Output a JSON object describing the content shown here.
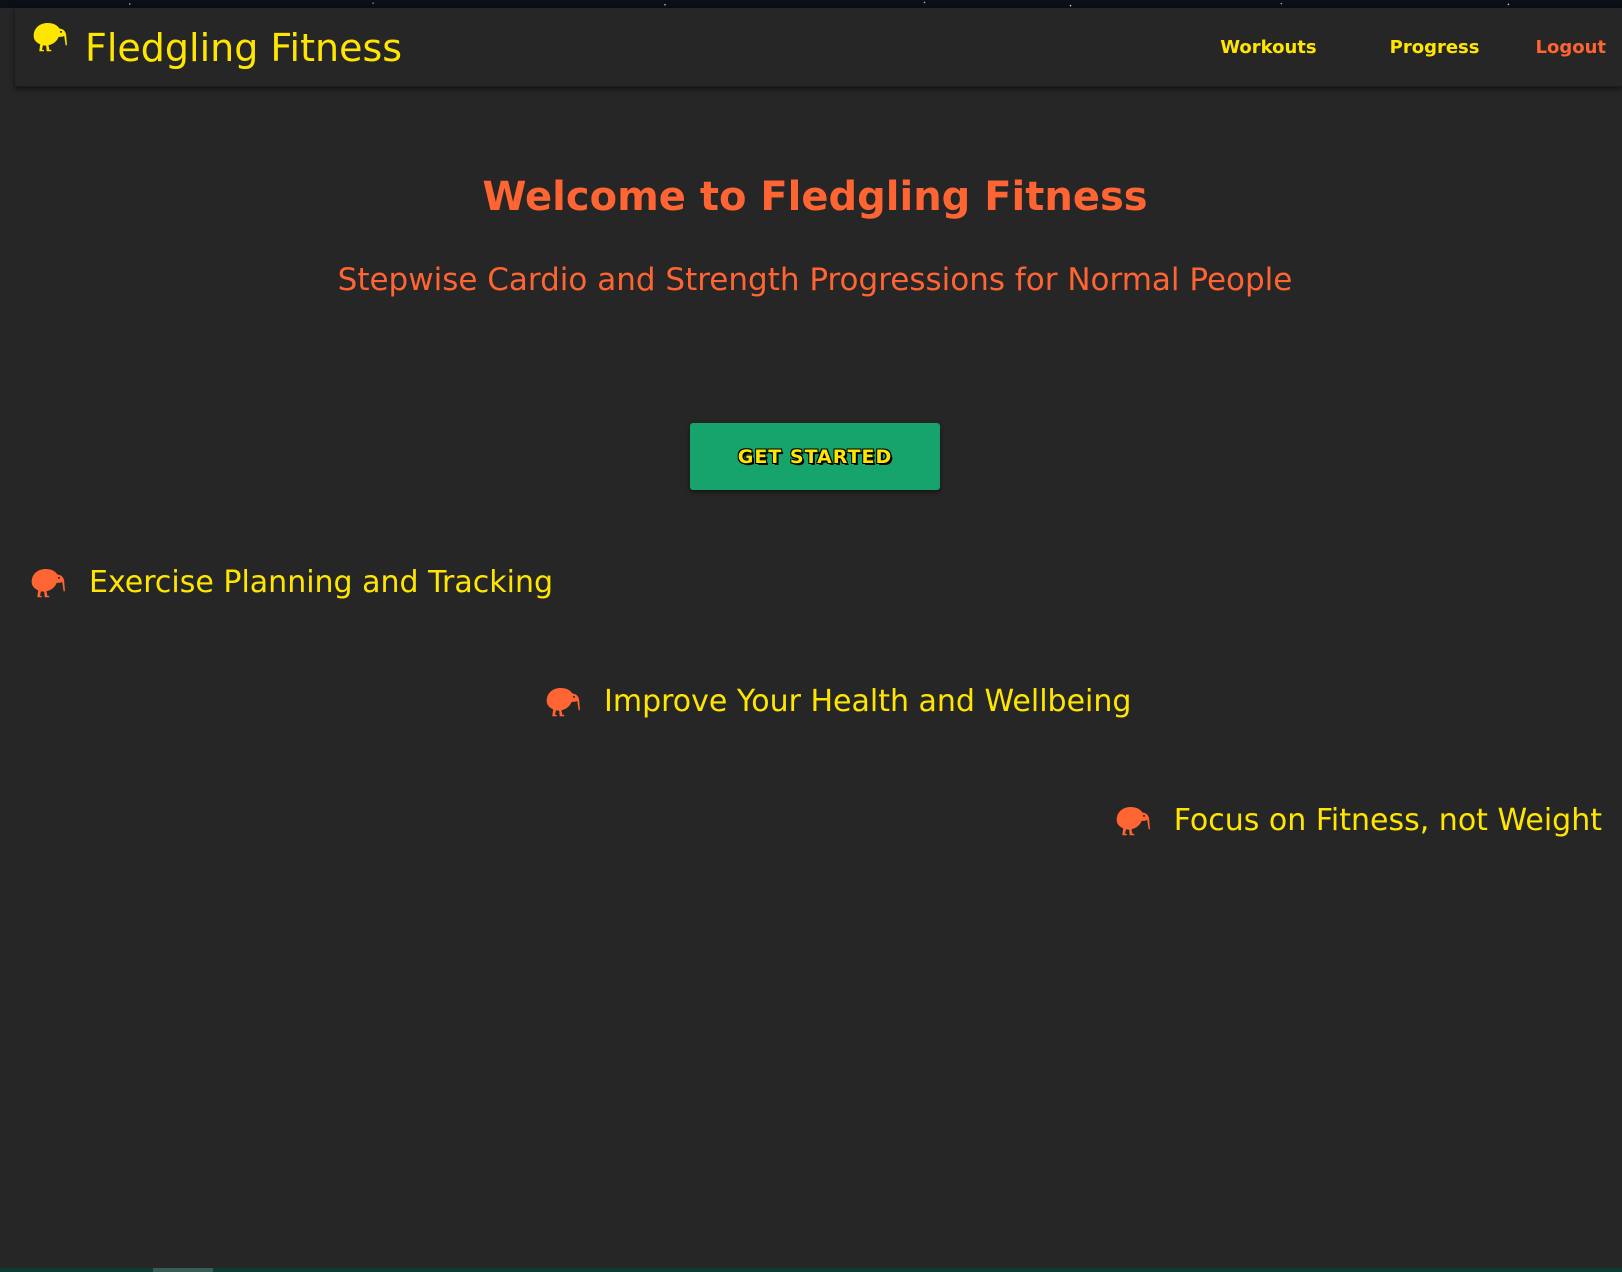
{
  "colors": {
    "background": "#262626",
    "accent_yellow": "#ffe600",
    "accent_orange": "#ff6433",
    "button_green": "#16a46c"
  },
  "navbar": {
    "brand_title": "Fledgling Fitness",
    "brand_icon": "kiwi-bird-icon",
    "links": [
      {
        "label": "Workouts"
      },
      {
        "label": "Progress"
      },
      {
        "label": "Logout"
      }
    ]
  },
  "hero": {
    "title": "Welcome to Fledgling Fitness",
    "subtitle": "Stepwise Cardio and Strength Progressions for Normal People",
    "cta_label": "GET STARTED"
  },
  "features": [
    {
      "icon": "kiwi-bird-icon",
      "text": "Exercise Planning and Tracking"
    },
    {
      "icon": "kiwi-bird-icon",
      "text": "Improve Your Health and Wellbeing"
    },
    {
      "icon": "kiwi-bird-icon",
      "text": "Focus on Fitness, not Weight"
    }
  ]
}
